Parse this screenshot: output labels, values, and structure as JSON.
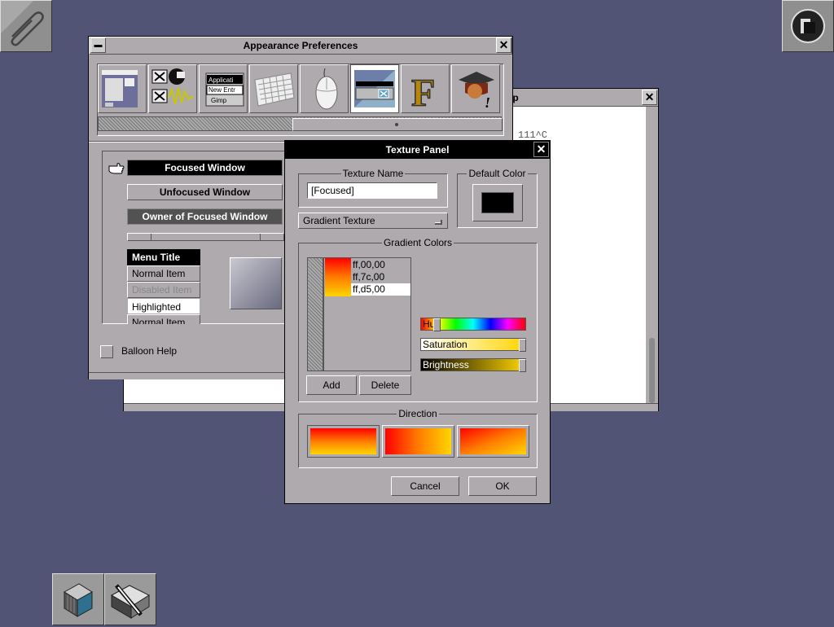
{
  "appearance": {
    "title": "Appearance Preferences",
    "focused_label": "Focused Window",
    "unfocused_label": "Unfocused Window",
    "owner_label": "Owner of Focused Window",
    "menu": {
      "title": "Menu Title",
      "normal1": "Normal Item",
      "disabled": "Disabled Item",
      "highlighted": "Highlighted",
      "normal2": "Normal Item"
    },
    "balloon_help": "Balloon Help",
    "toolbar_icons": [
      "window-prefs-icon",
      "icon-prefs-icon",
      "menu-prefs-icon",
      "keyboard-icon",
      "mouse-icon",
      "appearance-icon",
      "font-icon",
      "expert-icon"
    ],
    "menu_icon_text": {
      "line1": "Applicati",
      "line2": "New Entr",
      "line3": "Gimp"
    }
  },
  "background_window": {
    "title_fragment": "op",
    "text_fragment": "111^C"
  },
  "texture_panel": {
    "title": "Texture Panel",
    "texture_name_label": "Texture Name",
    "texture_name_value": "[Focused]",
    "default_color_label": "Default Color",
    "texture_type": "Gradient Texture",
    "gradient_colors_label": "Gradient Colors",
    "gradient_colors": [
      "ff,00,00",
      "ff,7c,00",
      "ff,d5,00"
    ],
    "hue_label": "Hu",
    "saturation_label": "Saturation",
    "brightness_label": "Brightness",
    "add_label": "Add",
    "delete_label": "Delete",
    "direction_label": "Direction",
    "cancel_label": "Cancel",
    "ok_label": "OK"
  },
  "colors": {
    "desktop": "#525476",
    "panel": "#aeaaae",
    "title_active": "#000000",
    "gradient_start": "#ff0000",
    "gradient_mid": "#ff7c00",
    "gradient_end": "#ffd500"
  }
}
